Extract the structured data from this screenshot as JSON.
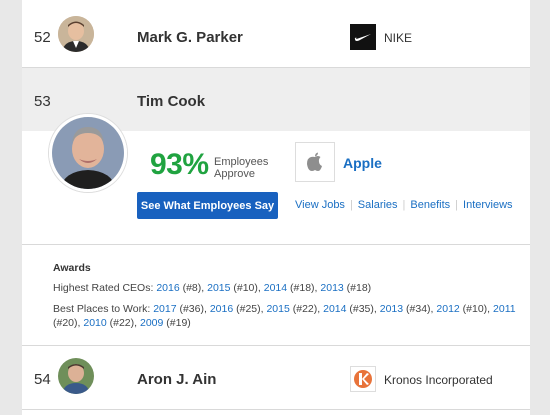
{
  "rows": [
    {
      "rank": "52",
      "name": "Mark G. Parker",
      "company": "NIKE"
    },
    {
      "rank": "53",
      "name": "Tim Cook",
      "company": "Apple",
      "approval": "93%",
      "approval_label_1": "Employees",
      "approval_label_2": "Approve",
      "cta": "See What Employees Say",
      "links": [
        "View Jobs",
        "Salaries",
        "Benefits",
        "Interviews"
      ],
      "awards": {
        "title": "Awards",
        "ceo_label": "Highest Rated CEOs:",
        "ceo": [
          {
            "year": "2016",
            "rank": "(#8)"
          },
          {
            "year": "2015",
            "rank": "(#10)"
          },
          {
            "year": "2014",
            "rank": "(#18)"
          },
          {
            "year": "2013",
            "rank": "(#18)"
          }
        ],
        "bptw_label": "Best Places to Work:",
        "bptw": [
          {
            "year": "2017",
            "rank": "(#36)"
          },
          {
            "year": "2016",
            "rank": "(#25)"
          },
          {
            "year": "2015",
            "rank": "(#22)"
          },
          {
            "year": "2014",
            "rank": "(#35)"
          },
          {
            "year": "2013",
            "rank": "(#34)"
          },
          {
            "year": "2012",
            "rank": "(#10)"
          },
          {
            "year": "2011",
            "rank": "(#20)"
          },
          {
            "year": "2010",
            "rank": "(#22)"
          },
          {
            "year": "2009",
            "rank": "(#19)"
          }
        ]
      }
    },
    {
      "rank": "54",
      "name": "Aron J. Ain",
      "company": "Kronos Incorporated"
    }
  ],
  "colors": {
    "approval": "#20a340",
    "link": "#1a6fc3",
    "button": "#1861bf",
    "highlight_row": "#eeeeee"
  }
}
